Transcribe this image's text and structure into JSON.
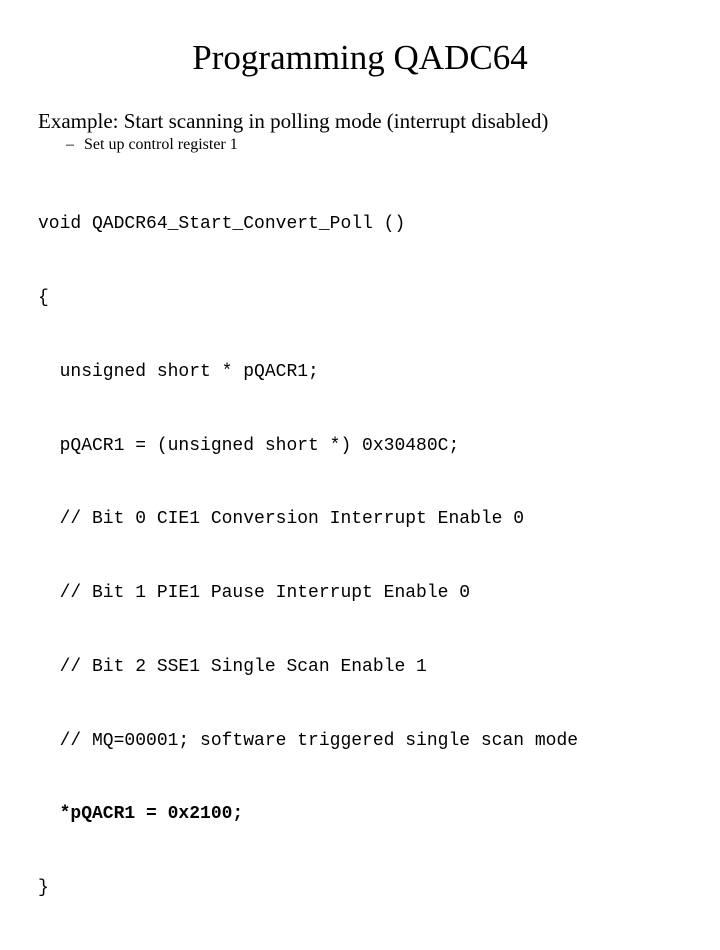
{
  "slide": {
    "title": "Programming QADC64",
    "background_color": "#ffffff",
    "text_color": "#000000",
    "bullets": [
      {
        "level": 1,
        "text": "Example: Start scanning in polling mode (interrupt disabled)"
      },
      {
        "level": 2,
        "marker": "–",
        "text": "Set up control register 1"
      }
    ],
    "code": {
      "language": "c",
      "lines": [
        {
          "text": "void QADCR64_Start_Convert_Poll ()",
          "bold": false
        },
        {
          "text": "{",
          "bold": false
        },
        {
          "text": "  unsigned short * pQACR1;",
          "bold": false
        },
        {
          "text": "  pQACR1 = (unsigned short *) 0x30480C;",
          "bold": false
        },
        {
          "text": "  // Bit 0 CIE1 Conversion Interrupt Enable 0",
          "bold": false
        },
        {
          "text": "  // Bit 1 PIE1 Pause Interrupt Enable 0",
          "bold": false
        },
        {
          "text": "  // Bit 2 SSE1 Single Scan Enable 1",
          "bold": false
        },
        {
          "text": "  // MQ=00001; software triggered single scan mode",
          "bold": false
        },
        {
          "text": "  *pQACR1 = 0x2100;",
          "bold": true
        },
        {
          "text": "}",
          "bold": false
        }
      ]
    }
  }
}
